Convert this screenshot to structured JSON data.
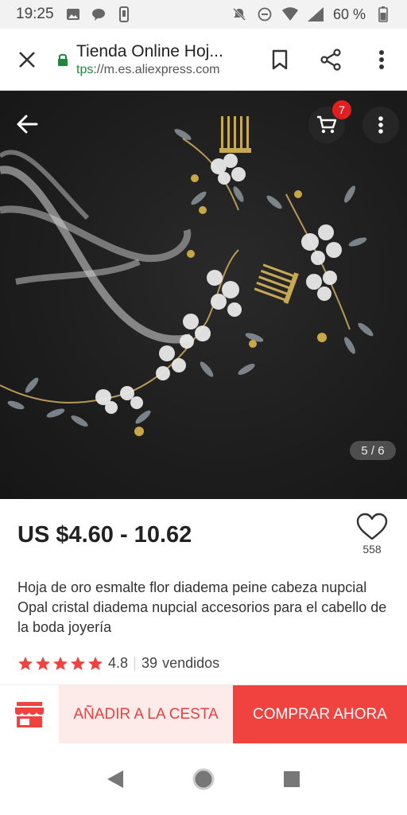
{
  "status_bar": {
    "time": "19:25",
    "battery": "60 %"
  },
  "browser": {
    "title": "Tienda Online Hoj...",
    "url_scheme": "tps",
    "url_rest": "://m.es.aliexpress.com"
  },
  "gallery": {
    "cart_count": "7",
    "page_indicator": "5 / 6",
    "current_page": 5,
    "total_pages": 6
  },
  "product": {
    "price": "US $4.60 - 10.62",
    "wishlist_count": "558",
    "title": "Hoja de oro esmalte flor diadema peine cabeza nupcial Opal cristal diadema nupcial accesorios para el cabello de la boda joyería",
    "rating": "4.8",
    "stars": 5,
    "sold_count": "39",
    "sold_label": "vendidos"
  },
  "actions": {
    "add_to_cart": "AÑADIR A LA CESTA",
    "buy_now": "COMPRAR AHORA"
  },
  "colors": {
    "accent": "#f0423f",
    "accent_light": "#fdebea",
    "secure": "#1a8a3a"
  },
  "icons": [
    "close-icon",
    "lock-icon",
    "bookmark-icon",
    "share-icon",
    "more-vert-icon",
    "back-arrow-icon",
    "cart-icon",
    "heart-icon",
    "star-icon",
    "store-icon",
    "nav-back-icon",
    "nav-home-icon",
    "nav-recents-icon"
  ]
}
